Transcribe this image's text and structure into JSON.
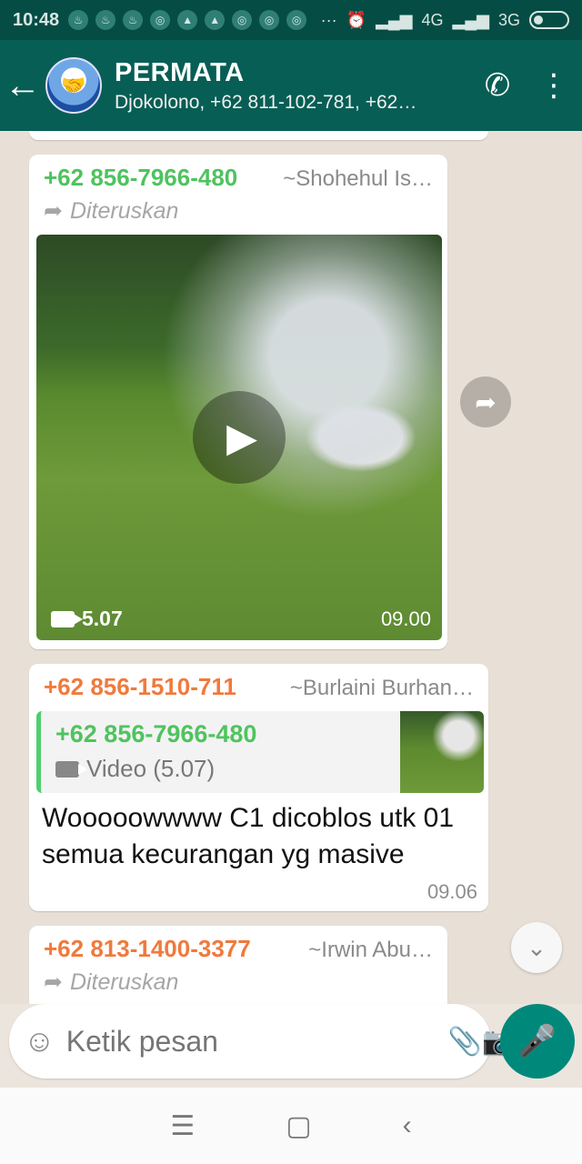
{
  "status_bar": {
    "time": "10:48",
    "network_labels": [
      "4G",
      "3G"
    ],
    "dots": "···"
  },
  "app_bar": {
    "title": "PERMATA",
    "subtitle": "Djokolono, +62 811-102-781, +62…"
  },
  "messages": [
    {
      "sender": "+62 856-7966-480",
      "alias": "~Shohehul Is…",
      "forwarded_label": "Diteruskan",
      "video_duration": "5.07",
      "time": "09.00"
    },
    {
      "sender": "+62 856-1510-711",
      "alias": "~Burlaini Burhan…",
      "quote_sender": "+62 856-7966-480",
      "quote_body": "Video (5.07)",
      "text": "Wooooowwww C1 dicoblos utk 01 semua kecurangan yg masive",
      "time": "09.06"
    },
    {
      "sender": "+62 813-1400-3377",
      "alias": "~Irwin Abu…",
      "forwarded_label": "Diteruskan"
    }
  ],
  "input": {
    "placeholder": "Ketik pesan"
  },
  "colors": {
    "header": "#075e54",
    "accent_green": "#4fc35f",
    "sender_orange": "#f07a3c",
    "fab": "#00897b"
  }
}
